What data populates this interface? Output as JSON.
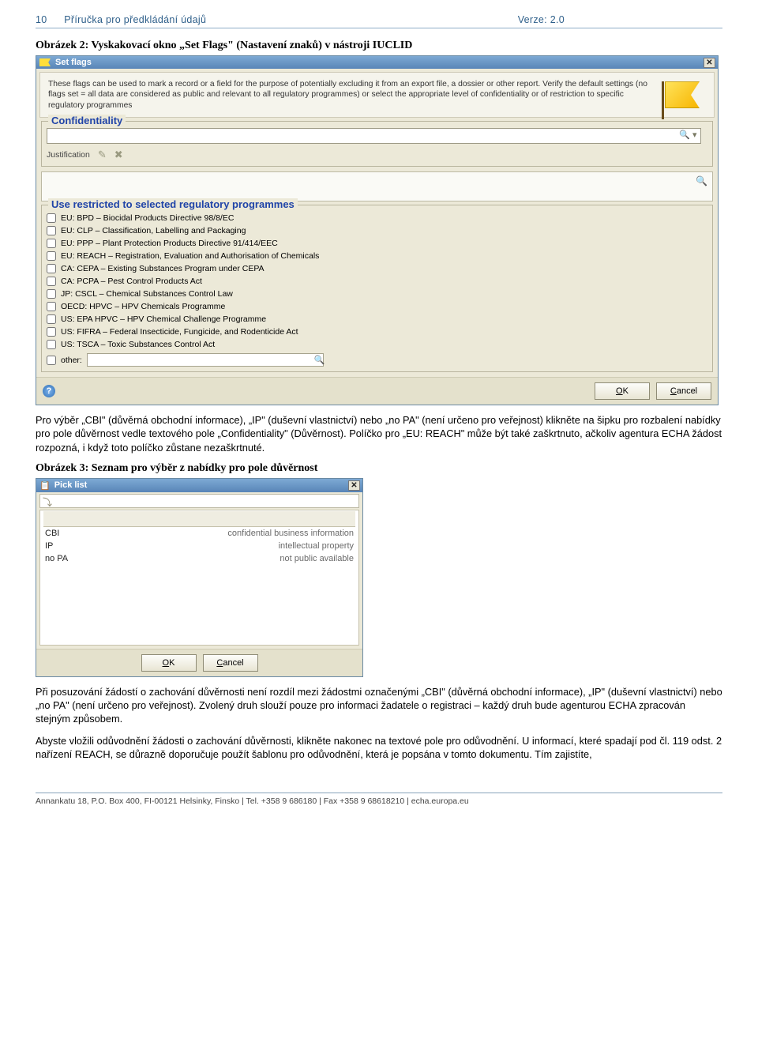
{
  "header": {
    "page": "10",
    "doc_title": "Příručka pro předkládání údajů",
    "version": "Verze: 2.0"
  },
  "captions": {
    "fig2": "Obrázek 2: Vyskakovací okno „Set Flags\" (Nastavení znaků) v nástroji IUCLID",
    "fig3": "Obrázek 3: Seznam pro výběr z nabídky pro pole důvěrnost"
  },
  "para1": "Pro výběr „CBI\" (důvěrná obchodní informace), „IP\" (duševní vlastnictví) nebo „no PA\" (není určeno pro veřejnost) klikněte na šipku pro rozbalení nabídky pro pole důvěrnost vedle textového pole „Confidentiality\" (Důvěrnost). Políčko pro „EU: REACH\" může být také zaškrtnuto, ačkoliv agentura ECHA žádost rozpozná, i když toto políčko zůstane nezaškrtnuté.",
  "para2": "Při posuzování žádostí o zachování důvěrnosti není rozdíl mezi žádostmi označenými „CBI\" (důvěrná obchodní informace), „IP\" (duševní vlastnictví) nebo „no PA\" (není určeno pro veřejnost). Zvolený druh slouží pouze pro informaci žadatele o registraci – každý druh bude agenturou ECHA zpracován stejným způsobem.",
  "para3": "Abyste vložili odůvodnění žádosti o zachování důvěrnosti, klikněte nakonec na textové pole pro odůvodnění. U informací, které spadají pod čl. 119 odst. 2 nařízení REACH, se důrazně doporučuje použít šablonu pro odůvodnění, která je popsána v tomto dokumentu. Tím zajistíte,",
  "dlg1": {
    "title": "Set flags",
    "desc": "These flags can be used to mark a record or a field for the purpose of potentially excluding it from an export file, a dossier or other report. Verify the default settings (no flags set = all data are considered as public and relevant to all regulatory programmes) or select the appropriate level of confidentiality or of restriction to specific regulatory programmes",
    "group_conf": "Confidentiality",
    "just_label": "Justification",
    "group_reg": "Use restricted to selected regulatory programmes",
    "items": [
      "EU: BPD – Biocidal Products Directive 98/8/EC",
      "EU: CLP – Classification, Labelling and Packaging",
      "EU: PPP – Plant Protection Products Directive 91/414/EEC",
      "EU: REACH – Registration, Evaluation and Authorisation of Chemicals",
      "CA: CEPA – Existing Substances Program under CEPA",
      "CA: PCPA – Pest Control Products Act",
      "JP: CSCL – Chemical Substances Control Law",
      "OECD: HPVC – HPV Chemicals Programme",
      "US: EPA HPVC – HPV Chemical Challenge Programme",
      "US: FIFRA – Federal Insecticide, Fungicide, and Rodenticide Act",
      "US: TSCA – Toxic Substances Control Act"
    ],
    "other_label": "other:",
    "ok": "OK",
    "cancel": "Cancel"
  },
  "dlg2": {
    "title": "Pick list",
    "rows": [
      {
        "k": "CBI",
        "v": "confidential business information"
      },
      {
        "k": "IP",
        "v": "intellectual property"
      },
      {
        "k": "no PA",
        "v": "not public available"
      }
    ],
    "ok": "OK",
    "cancel": "Cancel"
  },
  "footer": "Annankatu 18, P.O. Box 400, FI-00121 Helsinky, Finsko | Tel. +358 9 686180 | Fax +358 9 68618210 | echa.europa.eu"
}
